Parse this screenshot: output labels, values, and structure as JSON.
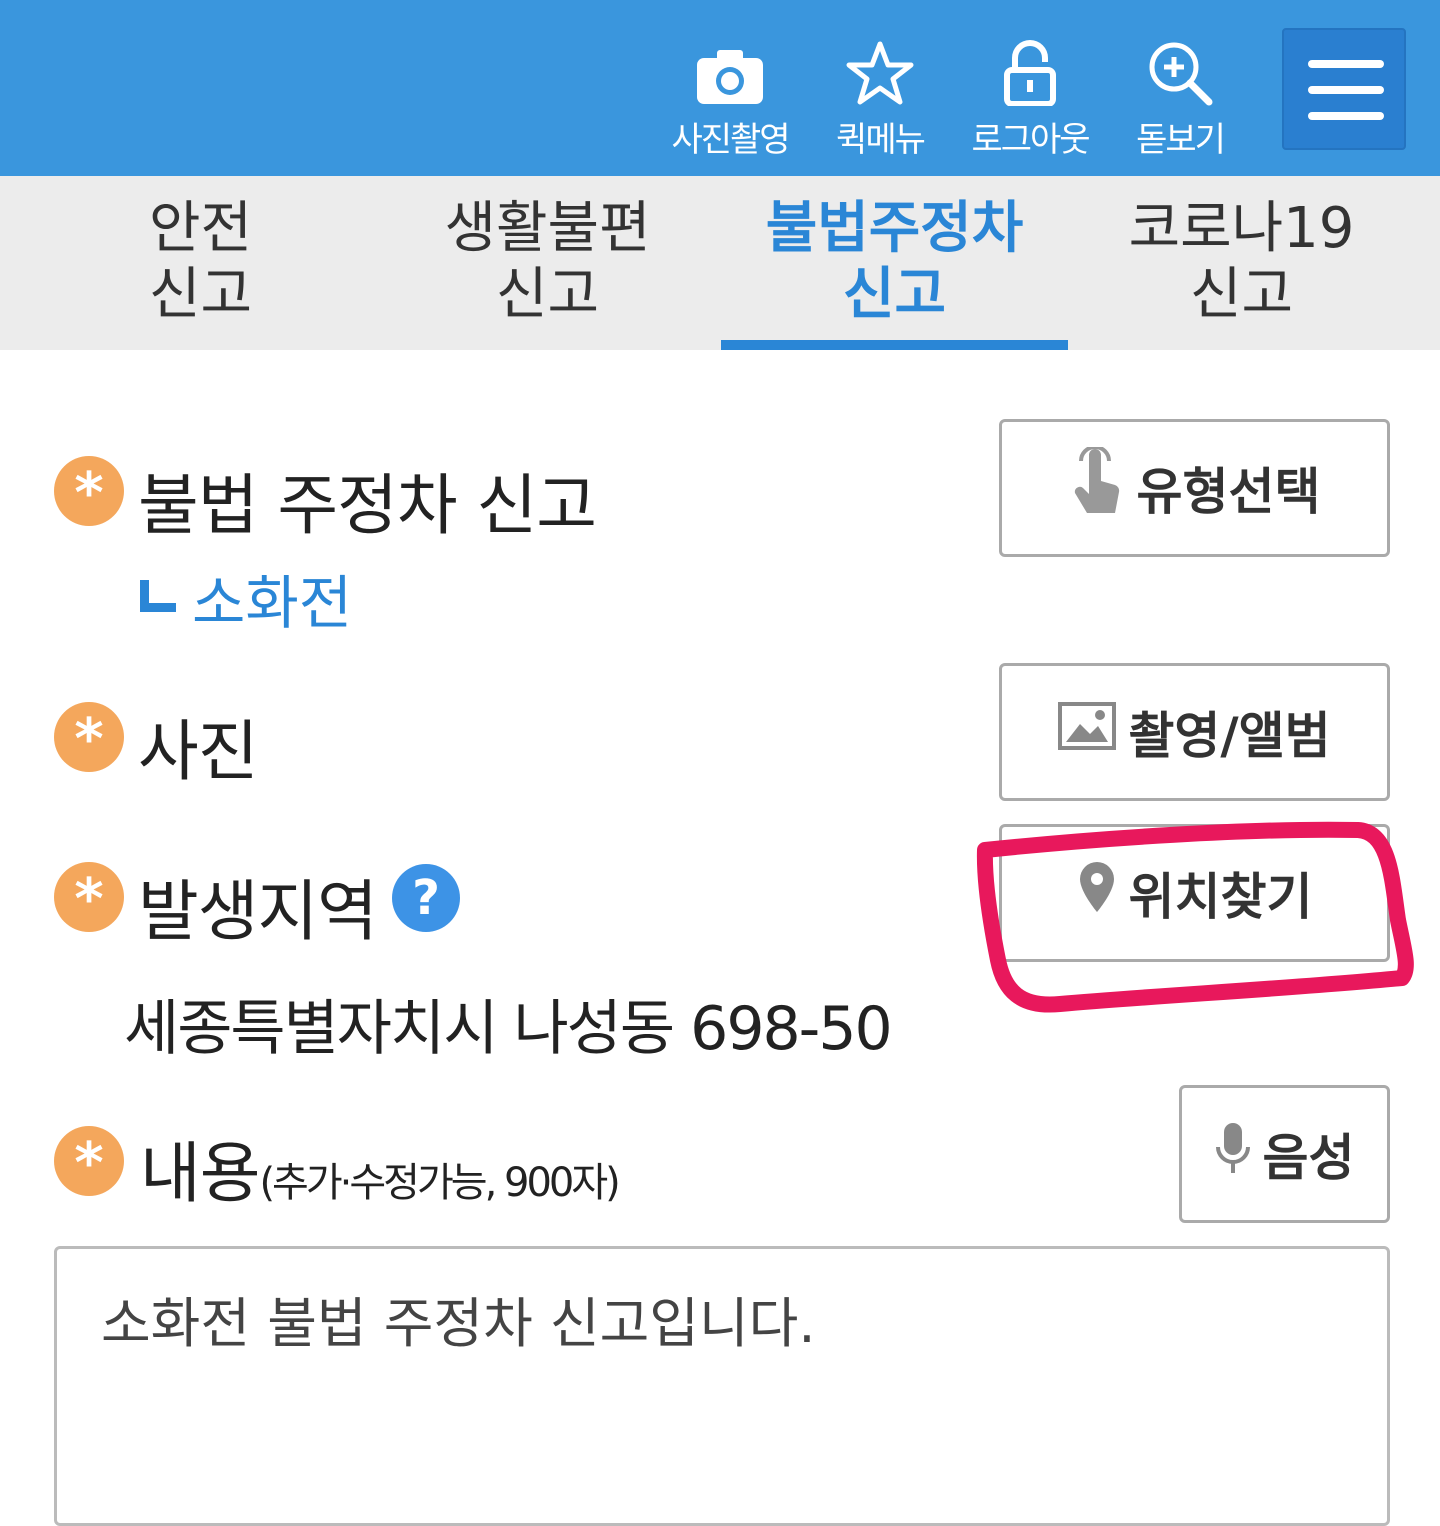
{
  "header": {
    "tools": [
      {
        "label": "사진촬영",
        "icon": "camera-icon"
      },
      {
        "label": "퀵메뉴",
        "icon": "star-icon"
      },
      {
        "label": "로그아웃",
        "icon": "lock-icon"
      },
      {
        "label": "돋보기",
        "icon": "zoom-in-icon"
      }
    ],
    "menu_icon": "hamburger-menu-icon",
    "background": "#3a96dd"
  },
  "tabs": [
    {
      "line1": "안전",
      "line2": "신고"
    },
    {
      "line1": "생활불편",
      "line2": "신고"
    },
    {
      "line1": "불법주정차",
      "line2": "신고",
      "active": true
    },
    {
      "line1": "코로나19",
      "line2": "신고"
    }
  ],
  "form": {
    "report": {
      "label": "불법 주정차 신고",
      "subtype": "소화전",
      "button": "유형선택",
      "button_icon": "touch-hand-icon"
    },
    "photo": {
      "label": "사진",
      "button": "촬영/앨범",
      "button_icon": "image-icon"
    },
    "location": {
      "label": "발생지역",
      "help": "?",
      "address": "세종특별자치시 나성동 698-50",
      "button": "위치찾기",
      "button_icon": "location-pin-icon"
    },
    "content": {
      "label": "내용",
      "note": "(추가·수정가능, 900자)",
      "button": "음성",
      "button_icon": "microphone-icon",
      "value": "소화전 불법 주정차 신고입니다."
    },
    "required_mark": "*"
  },
  "colors": {
    "accent": "#2a86d6",
    "required": "#f4a75c",
    "highlight": "#e8185c"
  }
}
